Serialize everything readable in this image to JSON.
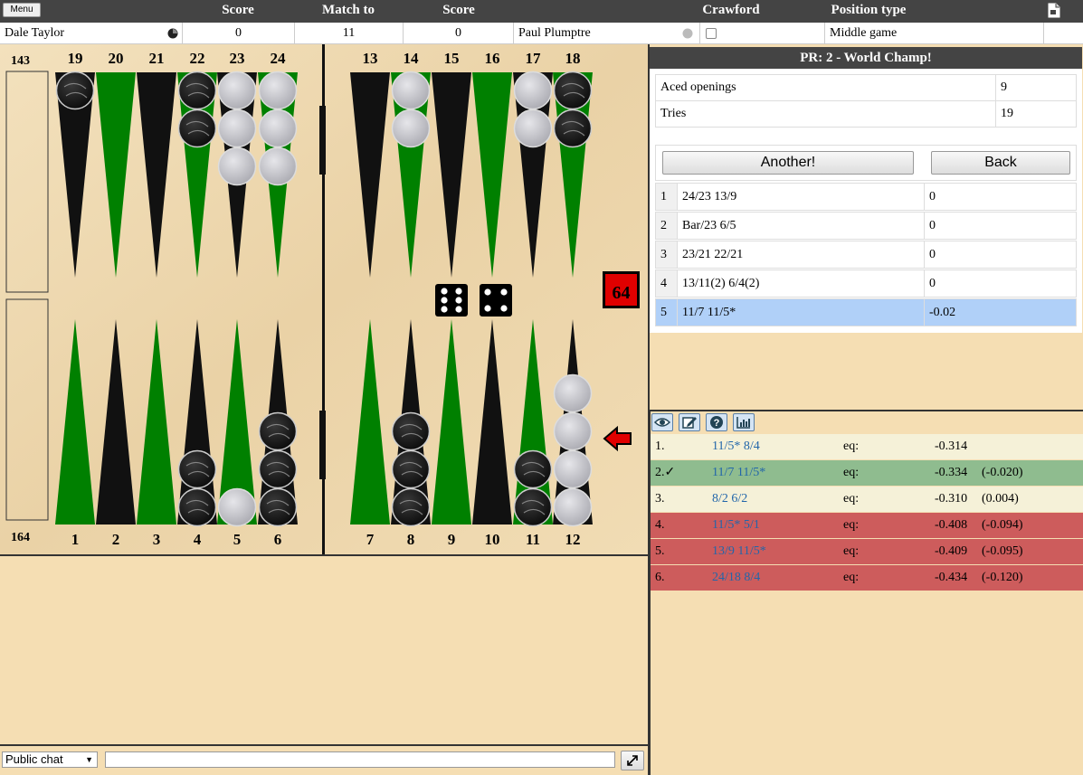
{
  "topbar": {
    "menu_label": "Menu",
    "headers": {
      "score1": "Score",
      "match_to": "Match to",
      "score2": "Score",
      "crawford": "Crawford",
      "position_type": "Position type"
    },
    "icon": "document-icon"
  },
  "info": {
    "player1": "Dale Taylor",
    "score1": "0",
    "match_to": "11",
    "score2": "0",
    "player2": "Paul Plumptre",
    "crawford_checked": false,
    "position_type": "Middle game"
  },
  "board": {
    "pip_top": "143",
    "pip_bottom": "164",
    "top_numbers": [
      "24",
      "23",
      "22",
      "21",
      "20",
      "19",
      "18",
      "17",
      "16",
      "15",
      "14",
      "13"
    ],
    "bottom_numbers": [
      "1",
      "2",
      "3",
      "4",
      "5",
      "6",
      "7",
      "8",
      "9",
      "10",
      "11",
      "12"
    ],
    "cube": "64",
    "dice": [
      6,
      4
    ],
    "colors": {
      "green": "#008000",
      "black": "#111111",
      "wood": "#f0dcb4",
      "cube": "#e00000"
    },
    "points": {
      "24": {
        "color": "black",
        "count": 1
      },
      "21": {
        "color": "black",
        "count": 2
      },
      "20": {
        "color": "white",
        "count": 3
      },
      "19": {
        "color": "white",
        "count": 3
      },
      "17": {
        "color": "white",
        "count": 2
      },
      "14": {
        "color": "white",
        "count": 2
      },
      "13": {
        "color": "black",
        "count": 2
      },
      "4": {
        "color": "black",
        "count": 2
      },
      "5": {
        "color": "white",
        "count": 1
      },
      "6": {
        "color": "black",
        "count": 3
      },
      "8": {
        "color": "black",
        "count": 3
      },
      "11": {
        "color": "black",
        "count": 2
      },
      "12": {
        "color": "white",
        "count": 4
      }
    }
  },
  "pr": {
    "title": "PR: 2 - World Champ!",
    "stats": [
      {
        "label": "Aced openings",
        "value": "9"
      },
      {
        "label": "Tries",
        "value": "19"
      }
    ],
    "another_label": "Another!",
    "back_label": "Back",
    "moves": [
      {
        "n": "1",
        "move": "24/23 13/9",
        "val": "0"
      },
      {
        "n": "2",
        "move": "Bar/23 6/5",
        "val": "0"
      },
      {
        "n": "3",
        "move": "23/21 22/21",
        "val": "0"
      },
      {
        "n": "4",
        "move": "13/11(2) 6/4(2)",
        "val": "0"
      },
      {
        "n": "5",
        "move": "11/7 11/5*",
        "val": "-0.02"
      }
    ]
  },
  "analysis": {
    "tools": [
      "eye-icon",
      "edit-icon",
      "help-icon",
      "chart-icon"
    ],
    "rows": [
      {
        "n": "1.",
        "move": "11/5* 8/4",
        "label": "eq:",
        "eq": "-0.314",
        "diff": "",
        "bg": "#f5f1d8"
      },
      {
        "n": "2.✓",
        "move": "11/7 11/5*",
        "label": "eq:",
        "eq": "-0.334",
        "diff": "(-0.020)",
        "bg": "#8fbc8f"
      },
      {
        "n": "3.",
        "move": "8/2 6/2",
        "label": "eq:",
        "eq": "-0.310",
        "diff": "(0.004)",
        "bg": "#f5f1d8"
      },
      {
        "n": "4.",
        "move": "11/5* 5/1",
        "label": "eq:",
        "eq": "-0.408",
        "diff": "(-0.094)",
        "bg": "#cd5c5c"
      },
      {
        "n": "5.",
        "move": "13/9 11/5*",
        "label": "eq:",
        "eq": "-0.409",
        "diff": "(-0.095)",
        "bg": "#cd5c5c"
      },
      {
        "n": "6.",
        "move": "24/18 8/4",
        "label": "eq:",
        "eq": "-0.434",
        "diff": "(-0.120)",
        "bg": "#cd5c5c"
      }
    ]
  },
  "chat": {
    "channel": "Public chat",
    "input_value": ""
  }
}
